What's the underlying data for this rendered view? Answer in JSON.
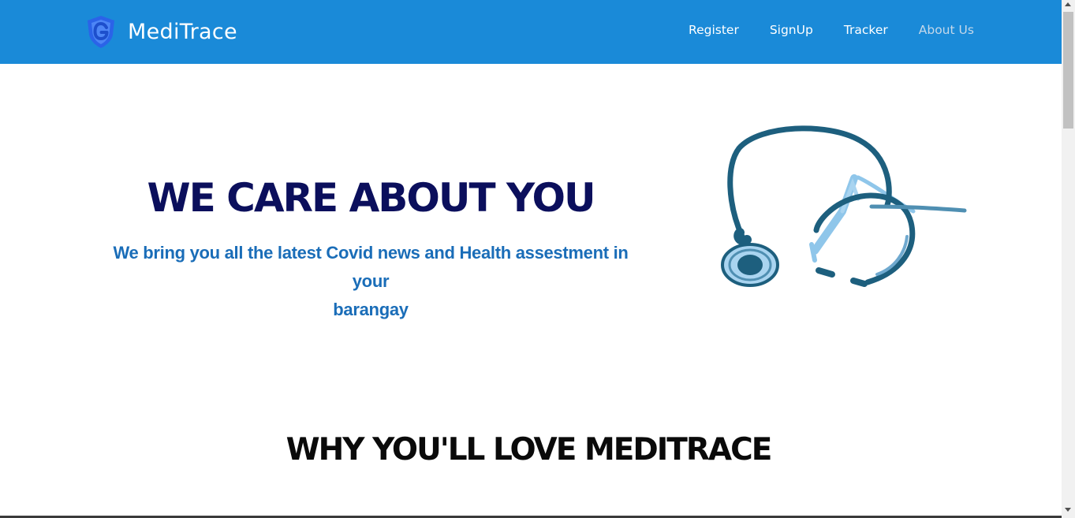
{
  "header": {
    "brand_name": "MediTrace",
    "brand_icon": "shield-g-icon",
    "nav": [
      {
        "label": "Register"
      },
      {
        "label": "SignUp"
      },
      {
        "label": "Tracker"
      },
      {
        "label": "About Us"
      }
    ]
  },
  "hero": {
    "title": "WE CARE ABOUT YOU",
    "subtitle_line1": "We bring you all the latest Covid news and Health assestment in your",
    "subtitle_line2": "barangay",
    "image_icon": "stethoscope-icon"
  },
  "section": {
    "title": "WHY YOU'LL LOVE MEDITRACE"
  },
  "colors": {
    "nav_bg": "#1a8ad8",
    "hero_title": "#0b0f5c",
    "hero_subtitle": "#1a6db8"
  }
}
